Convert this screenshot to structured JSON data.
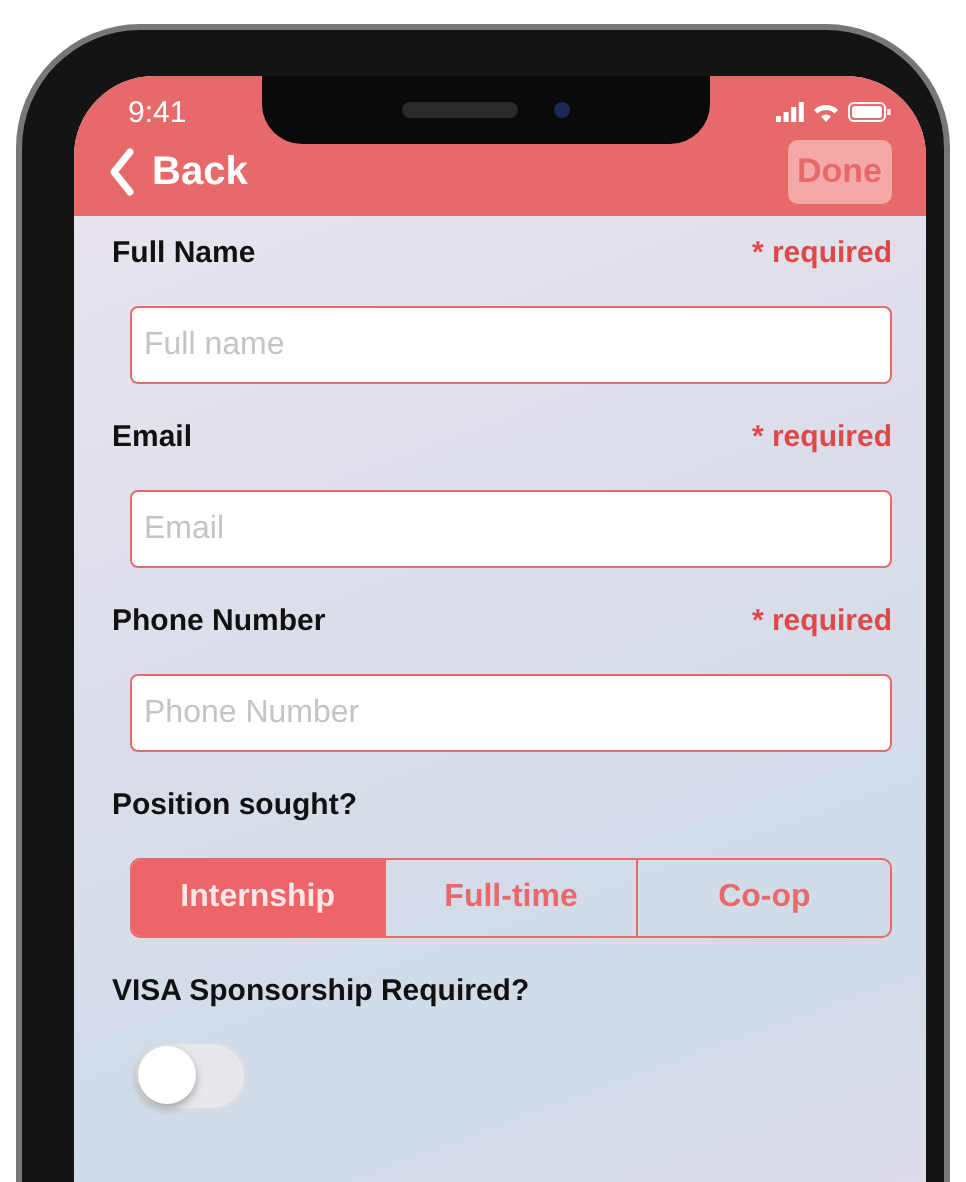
{
  "status_bar": {
    "time": "9:41"
  },
  "nav": {
    "back": "Back",
    "done": "Done"
  },
  "fields": [
    {
      "label": "Full Name",
      "required": "* required",
      "placeholder": "Full name"
    },
    {
      "label": "Email",
      "required": "* required",
      "placeholder": "Email"
    },
    {
      "label": "Phone Number",
      "required": "* required",
      "placeholder": "Phone Number"
    }
  ],
  "position": {
    "label": "Position sought?",
    "options": [
      {
        "label": "Internship",
        "selected": true
      },
      {
        "label": "Full-time",
        "selected": false
      },
      {
        "label": "Co-op",
        "selected": false
      }
    ]
  },
  "visa": {
    "label": "VISA Sponsorship Required?",
    "on": false
  }
}
